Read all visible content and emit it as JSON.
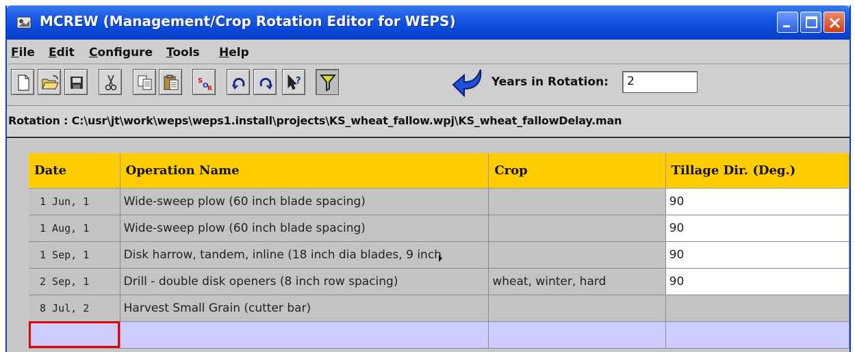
{
  "window": {
    "title": "MCREW (Management/Crop Rotation Editor for WEPS)"
  },
  "menu": [
    "File",
    "Edit",
    "Configure",
    "Tools",
    "Help"
  ],
  "toolbar": {
    "buttons": [
      "new-icon",
      "open-icon",
      "save-icon",
      "cut-icon",
      "copy-icon",
      "paste-icon",
      "sort-icon",
      "rotate-forward-icon",
      "rotate-back-icon",
      "help-icon",
      "filter-icon"
    ],
    "apply_icon": "undo-arrow-icon",
    "years_label": "Years in Rotation:",
    "years_value": "2"
  },
  "rotation": {
    "text": "Rotation : C:\\usr\\jt\\work\\weps\\weps1.install\\projects\\KS_wheat_fallow.wpj\\KS_wheat_fallowDelay.man"
  },
  "table": {
    "headers": [
      "Date",
      "Operation Name",
      "Crop",
      "Tillage Dir. (Deg.)"
    ],
    "rows": [
      {
        "date": "1 Jun, 1",
        "operation": "Wide-sweep plow (60 inch blade spacing)",
        "crop": "",
        "tillage": "90"
      },
      {
        "date": "1 Aug, 1",
        "operation": "Wide-sweep plow (60 inch blade spacing)",
        "crop": "",
        "tillage": "90"
      },
      {
        "date": "1 Sep, 1",
        "operation": "Disk harrow, tandem, inline (18 inch dia blades, 9 inch",
        "crop": "",
        "tillage": "90"
      },
      {
        "date": "2 Sep, 1",
        "operation": "Drill - double disk openers (8 inch row spacing)",
        "crop": "wheat, winter, hard",
        "tillage": "90"
      },
      {
        "date": "8 Jul, 2",
        "operation": "Harvest Small Grain (cutter bar)",
        "crop": "",
        "tillage": ""
      }
    ]
  },
  "colors": {
    "header": "#ffcc00",
    "new_row": "#ccccff",
    "selection": "#e00000",
    "titlebar": "#0b48d8"
  }
}
